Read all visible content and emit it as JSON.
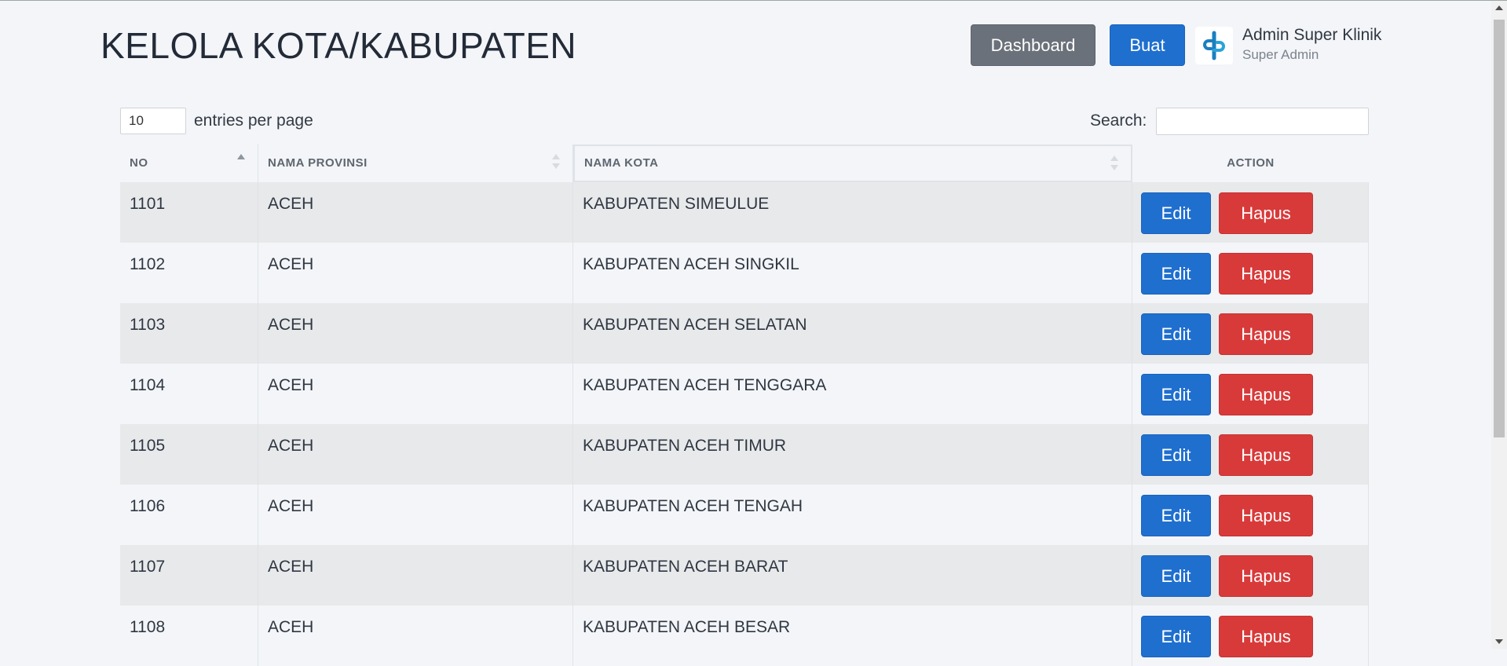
{
  "header": {
    "title": "KELOLA KOTA/KABUPATEN",
    "dashboard_label": "Dashboard",
    "create_label": "Buat",
    "user_name": "Admin Super Klinik",
    "user_role": "Super Admin"
  },
  "controls": {
    "entries_value": "10",
    "entries_label": "entries per page",
    "search_label": "Search:",
    "search_value": ""
  },
  "table": {
    "columns": [
      "NO",
      "NAMA PROVINSI",
      "NAMA KOTA",
      "ACTION"
    ],
    "sort": {
      "column": "NO",
      "direction": "asc"
    },
    "edit_label": "Edit",
    "delete_label": "Hapus",
    "rows": [
      {
        "no": "1101",
        "provinsi": "ACEH",
        "kota": "KABUPATEN SIMEULUE"
      },
      {
        "no": "1102",
        "provinsi": "ACEH",
        "kota": "KABUPATEN ACEH SINGKIL"
      },
      {
        "no": "1103",
        "provinsi": "ACEH",
        "kota": "KABUPATEN ACEH SELATAN"
      },
      {
        "no": "1104",
        "provinsi": "ACEH",
        "kota": "KABUPATEN ACEH TENGGARA"
      },
      {
        "no": "1105",
        "provinsi": "ACEH",
        "kota": "KABUPATEN ACEH TIMUR"
      },
      {
        "no": "1106",
        "provinsi": "ACEH",
        "kota": "KABUPATEN ACEH TENGAH"
      },
      {
        "no": "1107",
        "provinsi": "ACEH",
        "kota": "KABUPATEN ACEH BARAT"
      },
      {
        "no": "1108",
        "provinsi": "ACEH",
        "kota": "KABUPATEN ACEH BESAR"
      }
    ]
  },
  "colors": {
    "primary": "#1f6fcf",
    "secondary": "#6b717a",
    "danger": "#d83a3a",
    "background": "#f3f5f8",
    "row_striped": "#e8e9eb"
  }
}
